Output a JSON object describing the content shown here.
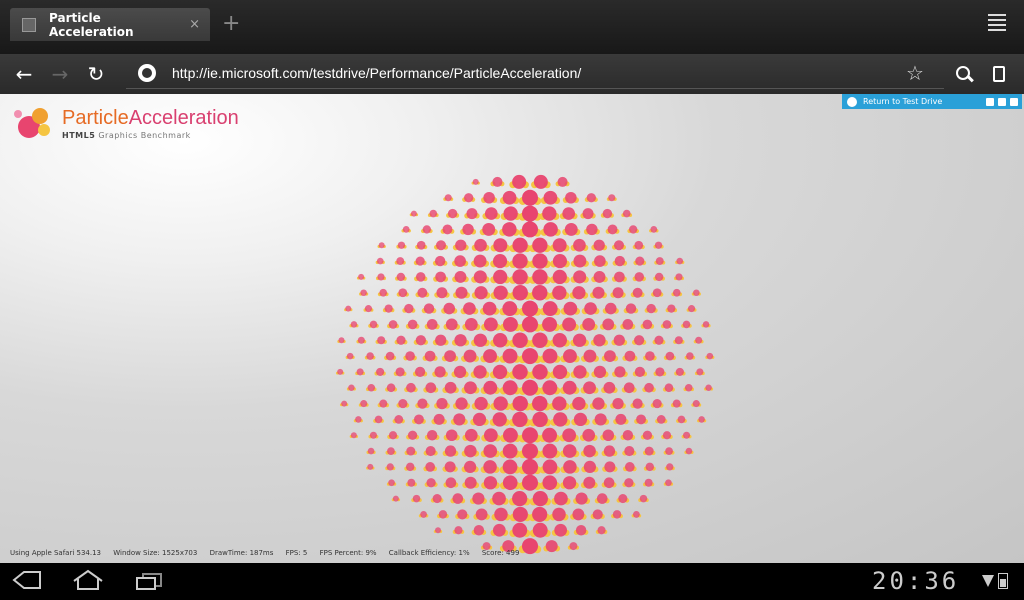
{
  "browser": {
    "tab": {
      "title": "Particle Acceleration",
      "close": "×"
    },
    "new_tab": "+",
    "nav": {
      "back": "←",
      "forward": "→",
      "reload": "↻",
      "url": "http://ie.microsoft.com/testdrive/Performance/ParticleAcceleration/",
      "star": "☆"
    }
  },
  "page": {
    "logo": {
      "title_part1": "Particle",
      "title_part2": "Acceleration",
      "subtitle_bold": "HTML5",
      "subtitle_rest": "Graphics Benchmark"
    },
    "return_bar": {
      "label": "Return to Test Drive"
    },
    "stats": {
      "browser": "Using Apple Safari 534.13",
      "window_size": "Window Size: 1525x703",
      "draw_time": "DrawTime: 187ms",
      "fps": "FPS: 5",
      "fps_percent": "FPS Percent: 9%",
      "callback_efficiency": "Callback Efficiency: 1%",
      "score": "Score: 499"
    },
    "colors": {
      "particle_pink": "#e8456f",
      "particle_yellow": "#f5c542",
      "accent_blue": "#2aa0d8"
    }
  },
  "system": {
    "clock": "20:36"
  }
}
